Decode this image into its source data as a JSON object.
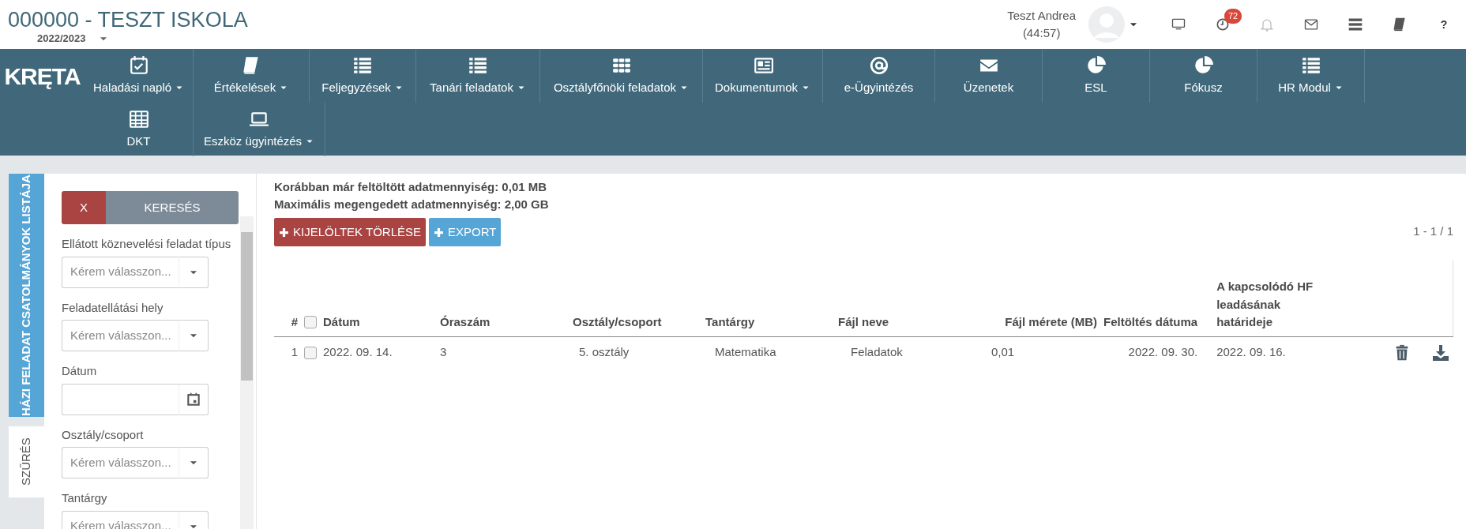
{
  "header": {
    "school_title": "000000 - TESZT ISKOLA",
    "school_year": "2022/2023",
    "user_name": "Teszt Andrea",
    "session_timer": "(44:57)",
    "toolbar": [
      {
        "kind": "monitor"
      },
      {
        "kind": "clock",
        "badge": "72"
      },
      {
        "kind": "bell"
      },
      {
        "kind": "mail"
      },
      {
        "kind": "server"
      },
      {
        "kind": "book"
      },
      {
        "kind": "help",
        "label": "?"
      }
    ]
  },
  "nav": {
    "logo": "KRĘTA",
    "rows": [
      [
        {
          "label": "Haladási napló",
          "kind": "calendar",
          "dropdown": true
        },
        {
          "label": "Értékelések",
          "kind": "book",
          "dropdown": true
        },
        {
          "label": "Feljegyzések",
          "kind": "list",
          "dropdown": true
        },
        {
          "label": "Tanári feladatok",
          "kind": "list",
          "dropdown": true
        },
        {
          "label": "Osztályfőnöki feladatok",
          "kind": "grid",
          "dropdown": true
        },
        {
          "label": "Dokumentumok",
          "kind": "news",
          "dropdown": true
        },
        {
          "label": "e-Ügyintézés",
          "kind": "at",
          "dropdown": false
        },
        {
          "label": "Üzenetek",
          "kind": "envelope",
          "dropdown": false
        },
        {
          "label": "ESL",
          "kind": "pie",
          "dropdown": false
        },
        {
          "label": "Fókusz",
          "kind": "pie",
          "dropdown": false
        },
        {
          "label": "HR Modul",
          "kind": "list",
          "dropdown": true
        }
      ],
      [
        {
          "label": "DKT",
          "kind": "table",
          "dropdown": false
        },
        {
          "label": "Eszköz ügyintézés",
          "kind": "laptop",
          "dropdown": true
        }
      ]
    ]
  },
  "side_tabs": [
    {
      "label": "HÁZI FELADAT CSATOLMÁNYOK LISTÁJA",
      "kind": "title"
    },
    {
      "label": "SZŰRÉS",
      "kind": "tab",
      "selected": true
    }
  ],
  "filter": {
    "clear_button": "X",
    "search_button": "KERESÉS",
    "fields": [
      {
        "label": "Ellátott köznevelési feladat típus",
        "kind": "select",
        "placeholder": "Kérem válasszon..."
      },
      {
        "label": "Feladatellátási hely",
        "kind": "select",
        "placeholder": "Kérem válasszon..."
      },
      {
        "label": "Dátum",
        "kind": "date"
      },
      {
        "label": "Osztály/csoport",
        "kind": "select",
        "placeholder": "Kérem válasszon..."
      },
      {
        "label": "Tantárgy",
        "kind": "select",
        "placeholder": "Kérem válasszon..."
      }
    ]
  },
  "info": [
    "Korábban már feltöltött adatmennyiség: 0,01 MB",
    "Maximális megengedett adatmennyiség: 2,00 GB"
  ],
  "actions": [
    {
      "label": "KIJELÖLTEK TÖRLÉSE",
      "kind": "danger"
    },
    {
      "label": "EXPORT",
      "kind": "info"
    }
  ],
  "pager": "1 - 1 / 1",
  "table": {
    "columns": [
      "#",
      "Dátum",
      "Óraszám",
      "Osztály/csoport",
      "Tantárgy",
      "Fájl neve",
      "Fájl mérete (MB)",
      "Feltöltés dátuma",
      "A kapcsolódó HF leadásának határideje"
    ],
    "header_checked": false,
    "rows": [
      {
        "cells": [
          "1",
          "2022. 09. 14.",
          "3",
          "5. osztály",
          "Matematika",
          "Feladatok",
          "0,01",
          "2022. 09. 30.",
          "2022. 09. 16."
        ],
        "checked": false
      }
    ]
  }
}
